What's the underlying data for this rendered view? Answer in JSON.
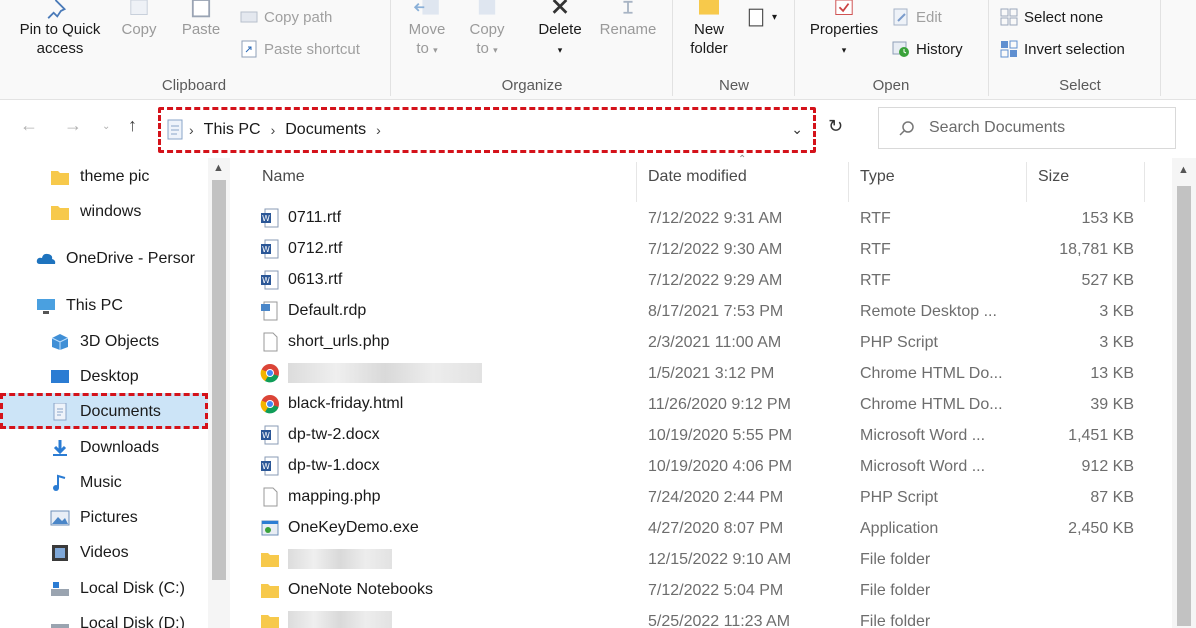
{
  "ribbon": {
    "clipboard": {
      "label": "Clipboard",
      "pin": "Pin to Quick access",
      "pin_line1": "Pin to Quick",
      "pin_line2": "access",
      "copy": "Copy",
      "paste": "Paste",
      "copy_path": "Copy path",
      "paste_shortcut": "Paste shortcut"
    },
    "organize": {
      "label": "Organize",
      "move_to_1": "Move",
      "move_to_2": "to",
      "copy_to_1": "Copy",
      "copy_to_2": "to",
      "delete": "Delete",
      "rename": "Rename"
    },
    "new": {
      "label": "New",
      "new_folder_1": "New",
      "new_folder_2": "folder"
    },
    "open": {
      "label": "Open",
      "properties": "Properties",
      "edit": "Edit",
      "history": "History"
    },
    "select": {
      "label": "Select",
      "select_none": "Select none",
      "invert_selection": "Invert selection"
    }
  },
  "address": {
    "crumbs": [
      "This PC",
      "Documents"
    ],
    "search_placeholder": "Search Documents"
  },
  "nav_pane": {
    "items": [
      {
        "label": "theme pic",
        "icon": "folder-icon"
      },
      {
        "label": "windows",
        "icon": "folder-icon"
      },
      {
        "label": "OneDrive - Persor",
        "icon": "cloud-icon"
      },
      {
        "label": "This PC",
        "icon": "pc-icon"
      },
      {
        "label": "3D Objects",
        "icon": "cube-icon"
      },
      {
        "label": "Desktop",
        "icon": "desktop-icon"
      },
      {
        "label": "Documents",
        "icon": "documents-icon"
      },
      {
        "label": "Downloads",
        "icon": "download-icon"
      },
      {
        "label": "Music",
        "icon": "music-icon"
      },
      {
        "label": "Pictures",
        "icon": "pictures-icon"
      },
      {
        "label": "Videos",
        "icon": "videos-icon"
      },
      {
        "label": "Local Disk (C:)",
        "icon": "drive-icon"
      },
      {
        "label": "Local Disk (D:)",
        "icon": "drive-icon"
      }
    ]
  },
  "file_list": {
    "columns": [
      "Name",
      "Date modified",
      "Type",
      "Size"
    ],
    "rows": [
      {
        "name": "0711.rtf",
        "date": "7/12/2022 9:31 AM",
        "type": "RTF",
        "size": "153 KB",
        "icon": "word-doc-icon"
      },
      {
        "name": "0712.rtf",
        "date": "7/12/2022 9:30 AM",
        "type": "RTF",
        "size": "18,781 KB",
        "icon": "word-doc-icon"
      },
      {
        "name": "0613.rtf",
        "date": "7/12/2022 9:29 AM",
        "type": "RTF",
        "size": "527 KB",
        "icon": "word-doc-icon"
      },
      {
        "name": "Default.rdp",
        "date": "8/17/2021 7:53 PM",
        "type": "Remote Desktop ...",
        "size": "3 KB",
        "icon": "rdp-icon"
      },
      {
        "name": "short_urls.php",
        "date": "2/3/2021 11:00 AM",
        "type": "PHP Script",
        "size": "3 KB",
        "icon": "blank-file-icon"
      },
      {
        "name": "",
        "date": "1/5/2021 3:12 PM",
        "type": "Chrome HTML Do...",
        "size": "13 KB",
        "icon": "chrome-icon",
        "blurred": true
      },
      {
        "name": "black-friday.html",
        "date": "11/26/2020 9:12 PM",
        "type": "Chrome HTML Do...",
        "size": "39 KB",
        "icon": "chrome-icon"
      },
      {
        "name": "dp-tw-2.docx",
        "date": "10/19/2020 5:55 PM",
        "type": "Microsoft Word ...",
        "size": "1,451 KB",
        "icon": "word-doc-icon"
      },
      {
        "name": "dp-tw-1.docx",
        "date": "10/19/2020 4:06 PM",
        "type": "Microsoft Word ...",
        "size": "912 KB",
        "icon": "word-doc-icon"
      },
      {
        "name": "mapping.php",
        "date": "7/24/2020 2:44 PM",
        "type": "PHP Script",
        "size": "87 KB",
        "icon": "blank-file-icon"
      },
      {
        "name": "OneKeyDemo.exe",
        "date": "4/27/2020 8:07 PM",
        "type": "Application",
        "size": "2,450 KB",
        "icon": "exe-icon"
      },
      {
        "name": "",
        "date": "12/15/2022 9:10 AM",
        "type": "File folder",
        "size": "",
        "icon": "folder-icon",
        "blurred": true
      },
      {
        "name": "OneNote Notebooks",
        "date": "7/12/2022 5:04 PM",
        "type": "File folder",
        "size": "",
        "icon": "folder-icon"
      },
      {
        "name": "",
        "date": "5/25/2022 11:23 AM",
        "type": "File folder",
        "size": "",
        "icon": "folder-icon",
        "blurred": true
      }
    ]
  },
  "colors": {
    "highlight_dash": "#d4121a",
    "selection": "#cce4f7",
    "folder": "#f7c94b",
    "accent": "#1e73be"
  }
}
